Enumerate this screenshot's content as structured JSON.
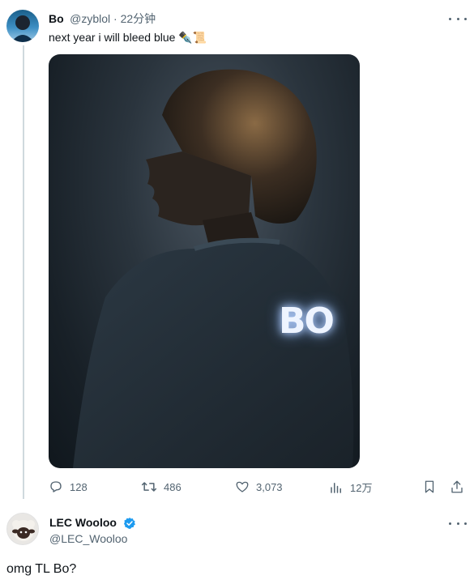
{
  "tweet": {
    "author_name": "Bo",
    "handle_time": "@zyblol · 22分钟",
    "text": "next year i will bleed blue ✒️📜",
    "photo_text": "BO",
    "actions": {
      "replies": "128",
      "retweets": "486",
      "likes": "3,073",
      "views": "12万"
    }
  },
  "reply": {
    "author_name": "LEC Wooloo",
    "handle": "@LEC_Wooloo",
    "text": "omg TL Bo?"
  },
  "colors": {
    "muted": "#536471",
    "verified": "#1d9bf0",
    "thread_line": "#cfd9de"
  },
  "icons": [
    "reply-icon",
    "retweet-icon",
    "like-icon",
    "views-icon",
    "bookmark-icon",
    "share-icon",
    "more-icon",
    "verified-icon"
  ]
}
